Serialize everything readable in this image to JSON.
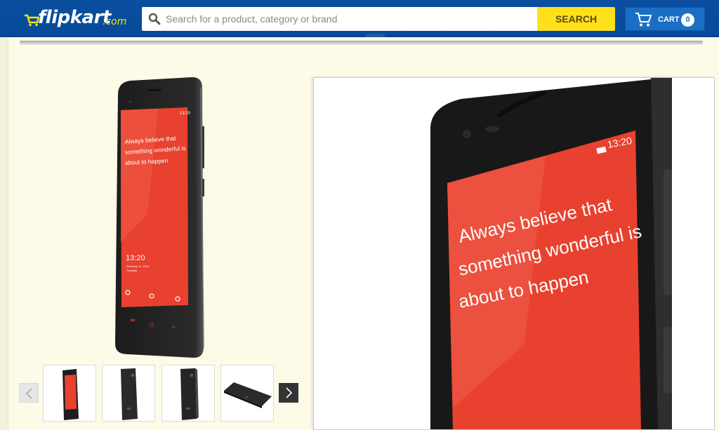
{
  "header": {
    "logo_text": "flipkart",
    "logo_suffix": ".com",
    "search": {
      "placeholder": "Search for a product, category or brand",
      "button_label": "SEARCH"
    },
    "cart": {
      "label": "CART",
      "count": "0"
    }
  },
  "product": {
    "screen_status_time": "13:20",
    "screen_quote_line1": "Always believe that",
    "screen_quote_line2": "something wonderful is",
    "screen_quote_line3": "about to happen",
    "screen_clock": "13:20",
    "screen_date": "February 11, 2014",
    "screen_day": "Tuesday"
  },
  "gallery": {
    "thumbnails": [
      "front",
      "back",
      "back-side",
      "flat"
    ]
  },
  "colors": {
    "header_bg": "#0a4fa0",
    "search_button": "#ffe11b",
    "cart_button": "#1a6ec3",
    "screen_red": "#e8412f",
    "page_bg": "#fdfbe8"
  }
}
